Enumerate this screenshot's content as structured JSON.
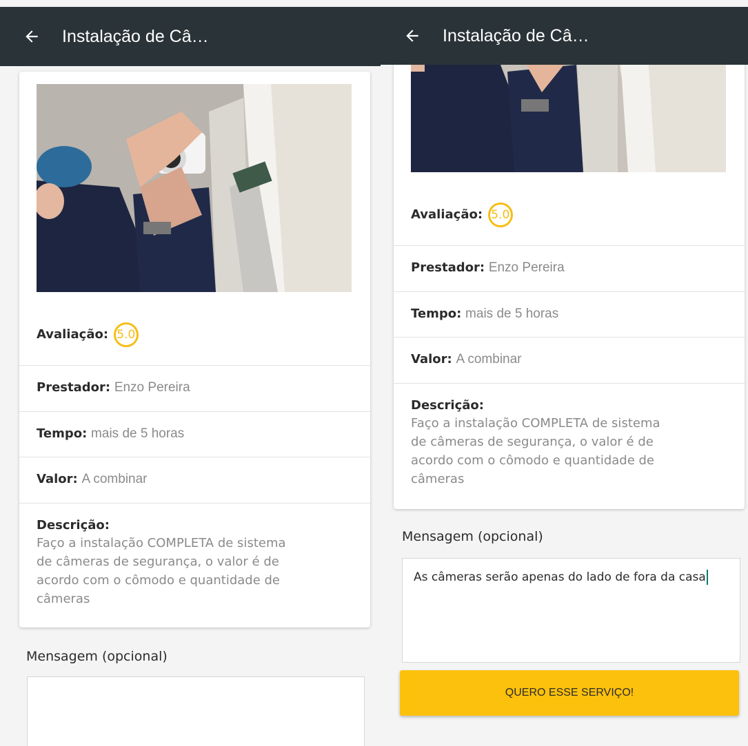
{
  "app_bar": {
    "title": "Instalação de Câ…"
  },
  "service": {
    "rating_label": "Avaliação:",
    "rating_value": "5.0",
    "provider_label": "Prestador:",
    "provider_value": "Enzo Pereira",
    "time_label": "Tempo:",
    "time_value": "mais de 5 horas",
    "price_label": "Valor:",
    "price_value": "A combinar",
    "description_label": "Descrição:",
    "description_lines": [
      "Faço a instalação COMPLETA de sistema",
      "de câmeras de segurança, o valor é de",
      "acordo com o cômodo e quantidade de",
      "câmeras"
    ]
  },
  "message": {
    "label": "Mensagem (opcional)",
    "left_value": "",
    "right_value": "As câmeras serão apenas do lado de fora da casa"
  },
  "cta": {
    "label": "QUERO ESSE SERVIÇO!"
  },
  "colors": {
    "appbar": "#2a3438",
    "accent": "#f5be17",
    "button": "#fcc10c"
  },
  "icons": {
    "back": "arrow-left-icon",
    "photo": "camera-installation-photo"
  }
}
